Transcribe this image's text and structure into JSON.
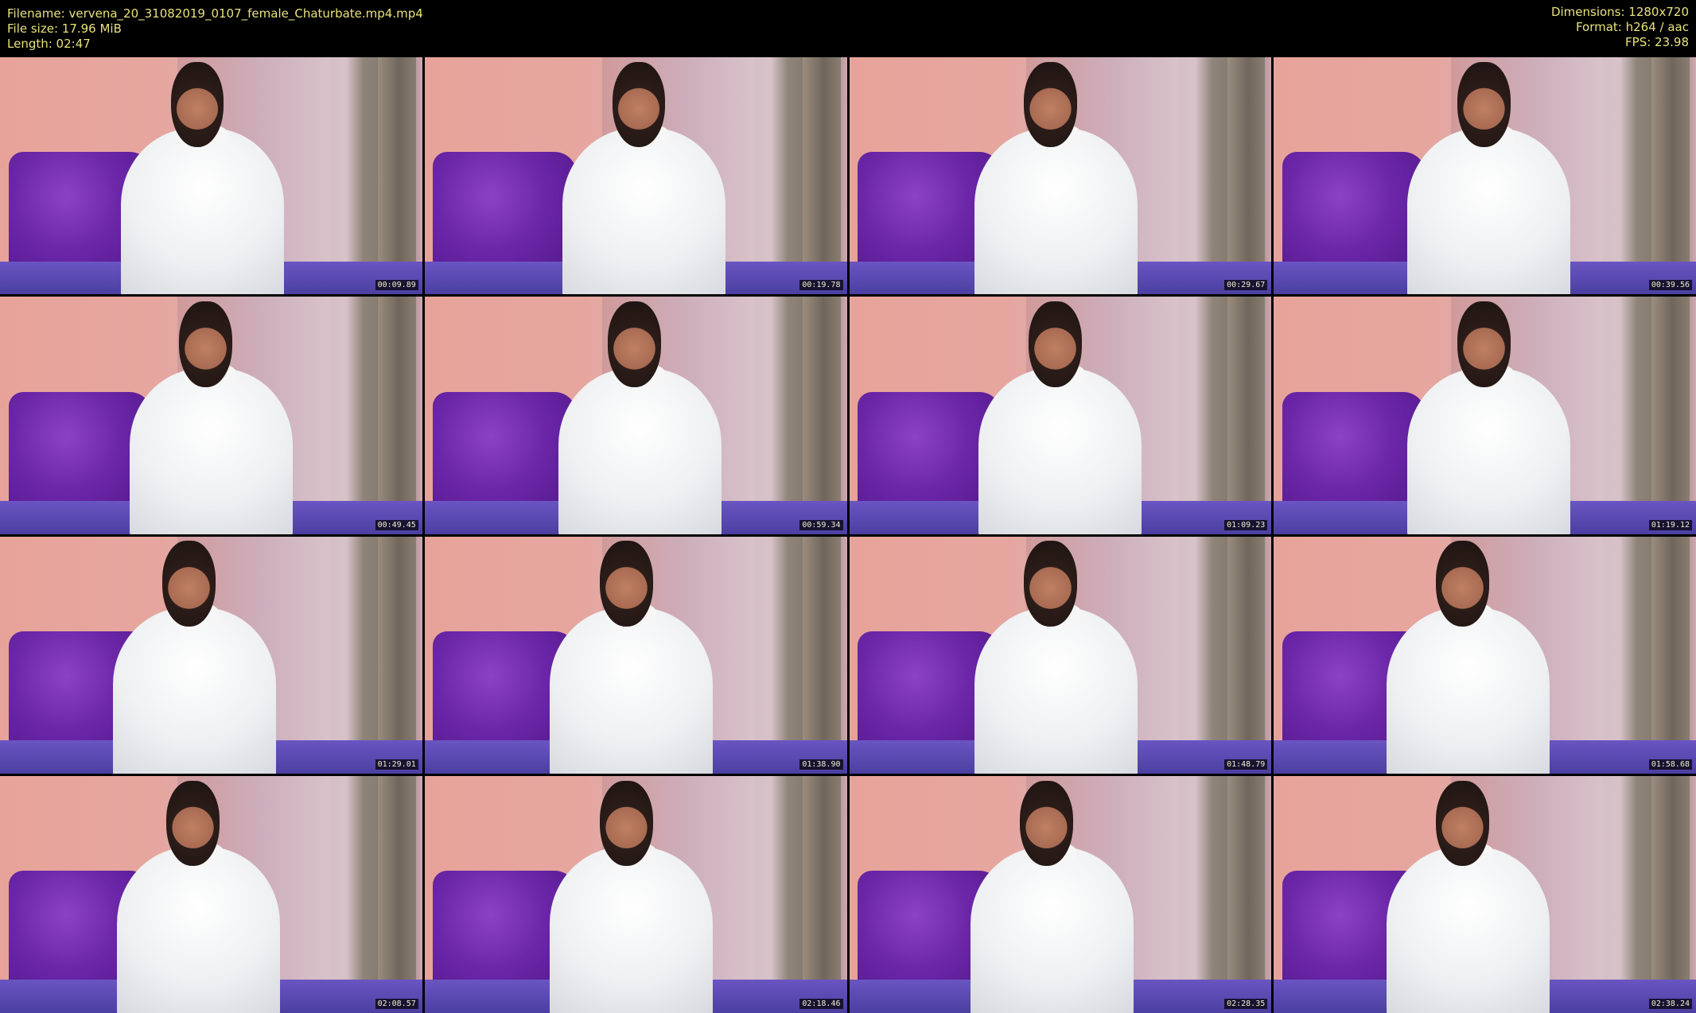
{
  "header": {
    "filename": "Filename: vervena_20_31082019_0107_female_Chaturbate.mp4.mp4",
    "filesize": "File size: 17.96 MiB",
    "length": "Length: 02:47",
    "dimensions": "Dimensions: 1280x720",
    "format": "Format: h264 / aac",
    "fps": "FPS: 23.98"
  },
  "thumbnails": [
    {
      "time": "00:09.89"
    },
    {
      "time": "00:19.78"
    },
    {
      "time": "00:29.67"
    },
    {
      "time": "00:39.56"
    },
    {
      "time": "00:49.45"
    },
    {
      "time": "00:59.34"
    },
    {
      "time": "01:09.23"
    },
    {
      "time": "01:19.12"
    },
    {
      "time": "01:29.01"
    },
    {
      "time": "01:38.90"
    },
    {
      "time": "01:48.79"
    },
    {
      "time": "01:58.68"
    },
    {
      "time": "02:08.57"
    },
    {
      "time": "02:18.46"
    },
    {
      "time": "02:28.35"
    },
    {
      "time": "02:38.24"
    }
  ],
  "colors": {
    "header_text": "#e8e27a",
    "background": "#000000"
  }
}
